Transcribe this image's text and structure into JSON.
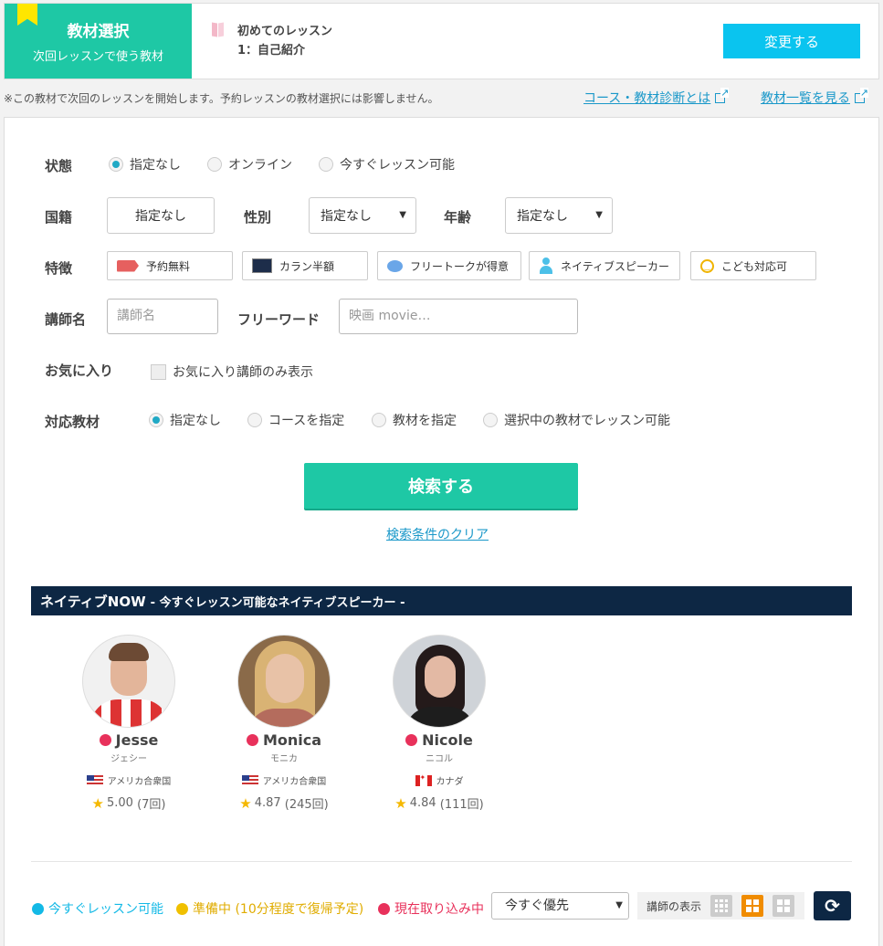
{
  "material": {
    "badge_title": "教材選択",
    "badge_sub": "次回レッスンで使う教材",
    "course": "初めてのレッスン",
    "lesson": "1：自己紹介",
    "change_button": "変更する"
  },
  "notice": {
    "text": "※この教材で次回のレッスンを開始します。予約レッスンの教材選択には影響しません。",
    "link_diagnosis": "コース・教材診断とは",
    "link_list": "教材一覧を見る"
  },
  "filters": {
    "status_label": "状態",
    "status_options": [
      "指定なし",
      "オンライン",
      "今すぐレッスン可能"
    ],
    "nationality_label": "国籍",
    "nationality_value": "指定なし",
    "gender_label": "性別",
    "gender_value": "指定なし",
    "age_label": "年齢",
    "age_value": "指定なし",
    "features_label": "特徴",
    "features": [
      "予約無料",
      "カラン半額",
      "フリートークが得意",
      "ネイティブスピーカー",
      "こども対応可"
    ],
    "teacher_name_label": "講師名",
    "teacher_name_placeholder": "講師名",
    "freeword_label": "フリーワード",
    "freeword_placeholder": "映画 movie…",
    "favorites_label": "お気に入り",
    "favorites_check": "お気に入り講師のみ表示",
    "material_label": "対応教材",
    "material_options": [
      "指定なし",
      "コースを指定",
      "教材を指定",
      "選択中の教材でレッスン可能"
    ],
    "search_button": "検索する",
    "clear_link": "検索条件のクリア"
  },
  "native_now": {
    "title": "ネイティブNOW",
    "subtitle": "- 今すぐレッスン可能なネイティブスピーカー -",
    "teachers": [
      {
        "name": "Jesse",
        "kana": "ジェシー",
        "country": "アメリカ合衆国",
        "rating": "5.00",
        "count": "(7回)"
      },
      {
        "name": "Monica",
        "kana": "モニカ",
        "country": "アメリカ合衆国",
        "rating": "4.87",
        "count": "(245回)"
      },
      {
        "name": "Nicole",
        "kana": "ニコル",
        "country": "カナダ",
        "rating": "4.84",
        "count": "(111回)"
      }
    ]
  },
  "footer": {
    "legend_available": "今すぐレッスン可能",
    "legend_preparing": "準備中 (10分程度で復帰予定)",
    "legend_busy": "現在取り込み中",
    "sort_value": "今すぐ優先",
    "view_label": "講師の表示"
  },
  "colors": {
    "accent": "#1ec8a5",
    "button_blue": "#0ac4ef",
    "navy": "#0d2744",
    "available": "#13b9e6",
    "preparing": "#f0c000",
    "busy": "#e8315b",
    "view_active": "#f08c00"
  }
}
